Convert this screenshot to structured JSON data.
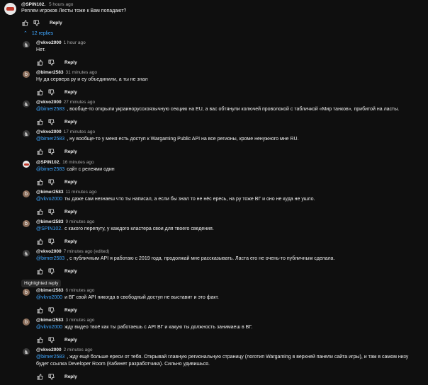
{
  "top_comment": {
    "author": "@SPIN102.",
    "timestamp": "5 hours ago",
    "text": "Реплеи игроков Лесты тоже к Вам попадают?",
    "reply_label": "Reply"
  },
  "replies_toggle": "12 replies",
  "highlighted_label": "Highlighted reply",
  "replies": [
    {
      "author": "@vkvo2000",
      "timestamp": "1 hour ago",
      "mention": "",
      "text": "Нет.",
      "reply_label": "Reply"
    },
    {
      "author": "@bimer2583",
      "timestamp": "31 minutes ago",
      "mention": "",
      "text": "Ну да сервера ру и еу объединили, а ты не знал",
      "reply_label": "Reply"
    },
    {
      "author": "@vkvo2000",
      "timestamp": "27 minutes ago",
      "mention": "@bimer2583",
      "text": ", вообще-то открыли украинорусскоязычную секцию на EU, а вас обтянули колючей проволокой с табличкой «Мир танков», прибитой на ласты.",
      "reply_label": "Reply"
    },
    {
      "author": "@vkvo2000",
      "timestamp": "17 minutes ago",
      "mention": "@bimer2583",
      "text": ", ну вообще-то у меня есть доступ к Wargaming Public API на все регионы, кроме ненужного мне RU.",
      "reply_label": "Reply"
    },
    {
      "author": "@SPIN102.",
      "timestamp": "16 minutes ago",
      "mention": "@bimer2583",
      "text": "сайт с релеями один",
      "reply_label": "Reply"
    },
    {
      "author": "@bimer2583",
      "timestamp": "11 minutes ago",
      "mention": "@vkvo2000",
      "text": "ты даже сам незнаеш что ты написал, а если бы знал то не нёс ересь, на ру тоже ВГ и оно не куда не ушло.",
      "reply_label": "Reply"
    },
    {
      "author": "@bimer2583",
      "timestamp": "9 minutes ago",
      "mention": "@SPIN102.",
      "text": "с какого перепугу, у каждого кластера свои для твоего сведения.",
      "reply_label": "Reply"
    },
    {
      "author": "@vkvo2000",
      "timestamp": "7 minutes ago (edited)",
      "mention": "@bimer2583",
      "text": ", с публичным API я работаю с 2019 года, продолжай мне рассказывать. Ласта его не очень-то публичным сделала.",
      "reply_label": "Reply"
    },
    {
      "author": "@bimer2583",
      "timestamp": "6 minutes ago",
      "mention": "@vkvo2000",
      "text": "и ВГ свой API никогда в свободный доступ не выставит и это факт.",
      "reply_label": "Reply"
    },
    {
      "author": "@bimer2583",
      "timestamp": "3 minutes ago",
      "mention": "@vkvo2000",
      "text": "жду видео твоё как ты работаешь с API ВГ и какую ты должность занимаеш в ВГ.",
      "reply_label": "Reply"
    },
    {
      "author": "@vkvo2000",
      "timestamp": "2 minutes ago",
      "mention": "@bimer2583",
      "text": ", жду ещё больше ереси от тебя. Открывай главную региональную страницу (логотип Wargaming в верхней панели сайта игры), и там в самом низу будет ссылка Developer Room (Кабинет разработчика). Сильно удивишься.",
      "reply_label": "Reply"
    }
  ]
}
